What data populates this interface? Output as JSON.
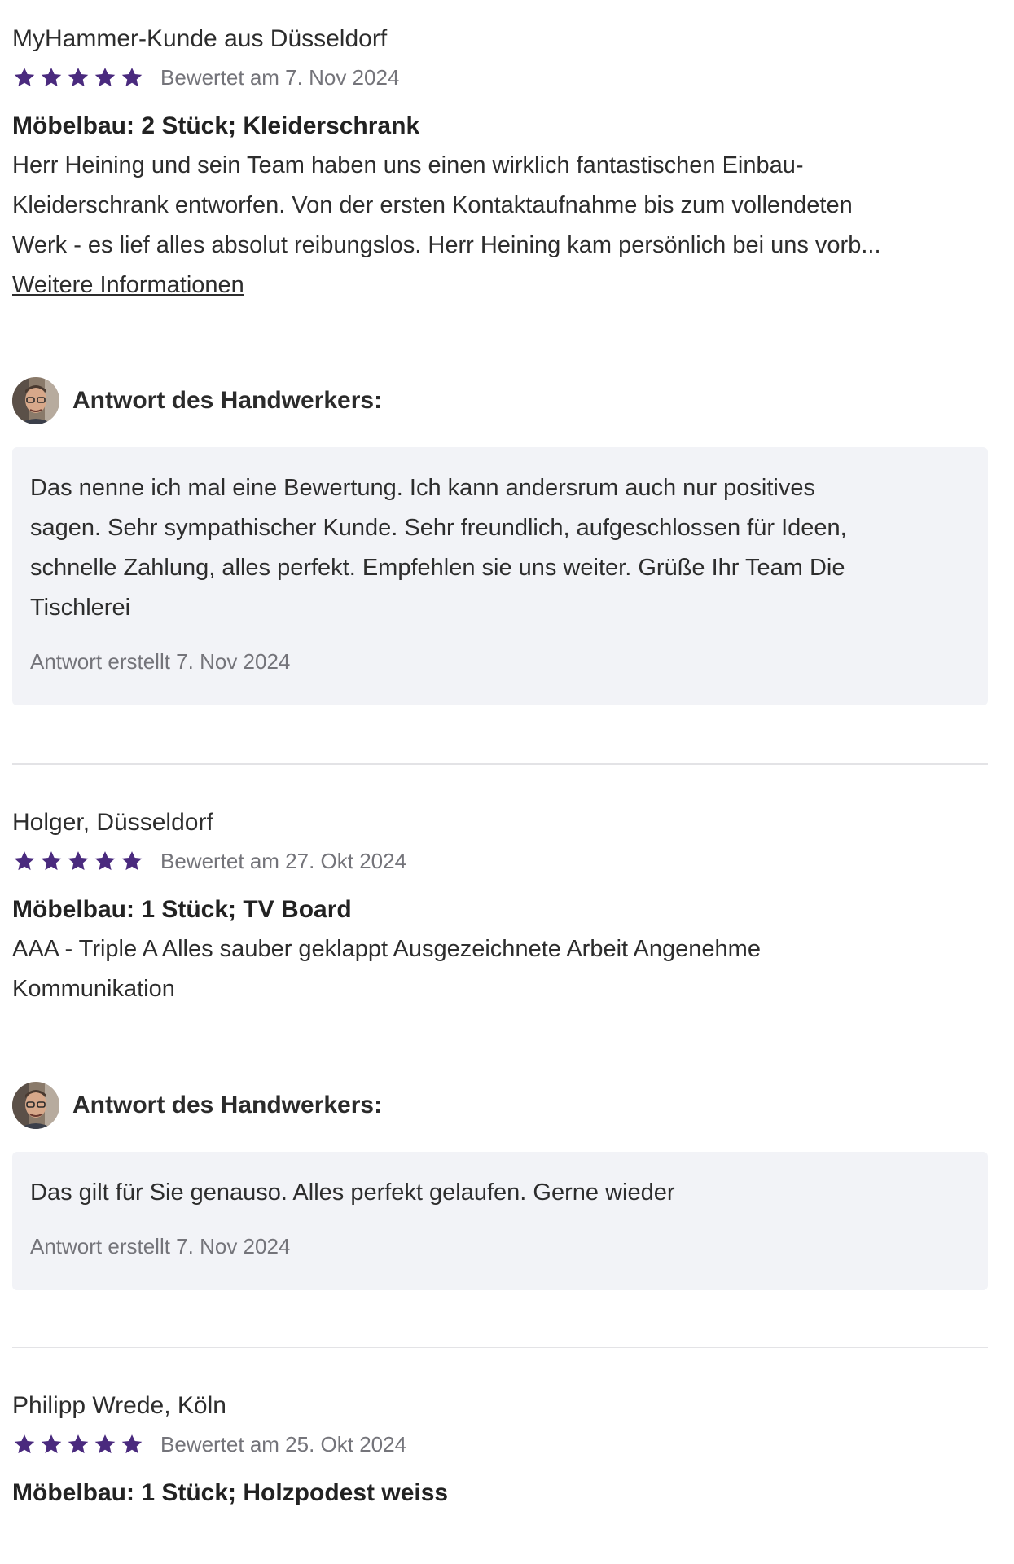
{
  "colors": {
    "star": "#4a2a7e",
    "reply_bg": "#f2f3f7",
    "muted_text": "#74747a",
    "divider": "#e3e3e6"
  },
  "reviews": [
    {
      "reviewer": "MyHammer-Kunde aus Düsseldorf",
      "rating": 5,
      "rated_date": "Bewertet am 7. Nov 2024",
      "job": "Möbelbau: 2 Stück; Kleiderschrank",
      "text_lines": [
        "Herr Heining und sein Team haben uns einen wirklich fantastischen Einbau-",
        "Kleiderschrank entworfen. Von der ersten Kontaktaufnahme bis zum vollendeten",
        "Werk - es lief alles absolut reibungslos. Herr Heining kam persönlich bei uns vorb..."
      ],
      "more_link": "Weitere Informationen",
      "reply": {
        "title": "Antwort des Handwerkers:",
        "text_lines": [
          "Das nenne ich mal eine Bewertung. Ich kann andersrum auch nur positives",
          "sagen. Sehr sympathischer Kunde. Sehr freundlich, aufgeschlossen für Ideen,",
          "schnelle Zahlung, alles perfekt. Empfehlen sie uns weiter. Grüße Ihr Team Die",
          "Tischlerei"
        ],
        "date": "Antwort erstellt 7. Nov 2024"
      }
    },
    {
      "reviewer": "Holger, Düsseldorf",
      "rating": 5,
      "rated_date": "Bewertet am 27. Okt 2024",
      "job": "Möbelbau: 1 Stück; TV Board",
      "text_lines": [
        "AAA - Triple A Alles sauber geklappt Ausgezeichnete Arbeit Angenehme",
        "Kommunikation"
      ],
      "reply": {
        "title": "Antwort des Handwerkers:",
        "text_lines": [
          "Das gilt für Sie genauso. Alles perfekt gelaufen. Gerne wieder"
        ],
        "date": "Antwort erstellt 7. Nov 2024"
      }
    },
    {
      "reviewer": "Philipp Wrede, Köln",
      "rating": 5,
      "rated_date": "Bewertet am 25. Okt 2024",
      "job": "Möbelbau: 1 Stück; Holzpodest weiss"
    }
  ]
}
